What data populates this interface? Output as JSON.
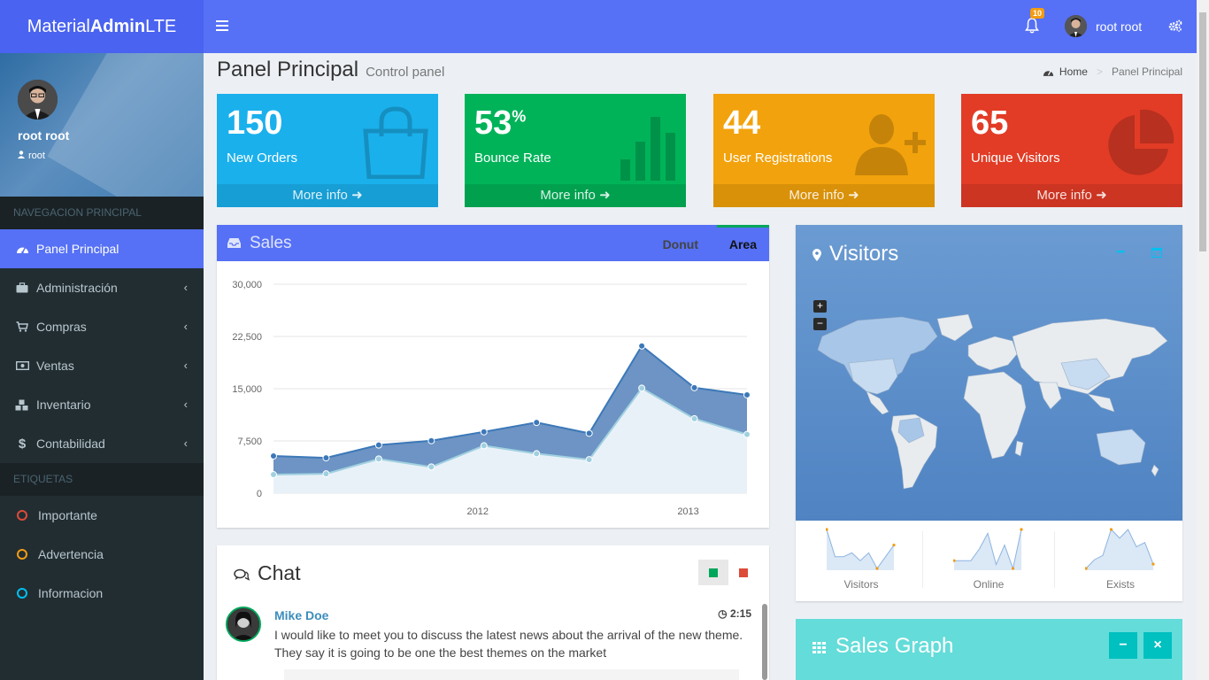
{
  "logo": {
    "prefix": "Material",
    "bold": "Admin",
    "suffix": "LTE"
  },
  "navbar": {
    "notifications": "10",
    "user": "root root"
  },
  "sidebar": {
    "user_name": "root root",
    "user_role": "root",
    "nav_header": "NAVEGACION PRINCIPAL",
    "items": [
      {
        "label": "Panel Principal",
        "icon": "dashboard-icon"
      },
      {
        "label": "Administración",
        "icon": "briefcase-icon"
      },
      {
        "label": "Compras",
        "icon": "cart-icon"
      },
      {
        "label": "Ventas",
        "icon": "money-icon"
      },
      {
        "label": "Inventario",
        "icon": "cubes-icon"
      },
      {
        "label": "Contabilidad",
        "icon": "dollar-icon"
      }
    ],
    "labels_header": "ETIQUETAS",
    "labels": [
      {
        "label": "Importante",
        "color": "#dd4b39"
      },
      {
        "label": "Advertencia",
        "color": "#f39c12"
      },
      {
        "label": "Informacion",
        "color": "#00c0ef"
      }
    ]
  },
  "content": {
    "title": "Panel Principal",
    "subtitle": "Control panel"
  },
  "breadcrumb": {
    "home": "Home",
    "current": "Panel Principal"
  },
  "stats": [
    {
      "value": "150",
      "suffix": "",
      "label": "New Orders",
      "more": "More info",
      "color": "#1ab0ec"
    },
    {
      "value": "53",
      "suffix": "%",
      "label": "Bounce Rate",
      "more": "More info",
      "color": "#00b359"
    },
    {
      "value": "44",
      "suffix": "",
      "label": "User Registrations",
      "more": "More info",
      "color": "#f2a20c"
    },
    {
      "value": "65",
      "suffix": "",
      "label": "Unique Visitors",
      "more": "More info",
      "color": "#e23c26"
    }
  ],
  "sales": {
    "title": "Sales",
    "tab_donut": "Donut",
    "tab_area": "Area"
  },
  "chart_data": {
    "type": "area",
    "x": [
      "2011 Q1",
      "2011 Q2",
      "2011 Q3",
      "2011 Q4",
      "2012 Q1",
      "2012 Q2",
      "2012 Q3",
      "2012 Q4",
      "2013 Q1",
      "2013 Q2"
    ],
    "x_tick_labels": [
      "2012",
      "2013"
    ],
    "series": [
      {
        "values": [
          2666,
          2778,
          4912,
          3767,
          6810,
          5670,
          4820,
          15073,
          10687,
          8432
        ]
      },
      {
        "values": [
          5332,
          5072,
          6912,
          7534,
          8810,
          10154,
          8599,
          21132,
          15147,
          14113
        ]
      }
    ],
    "yticks": [
      "30,000",
      "22,500",
      "15,000",
      "7,500",
      "0"
    ],
    "ylim": [
      0,
      30000
    ],
    "grid": true
  },
  "chat": {
    "title": "Chat",
    "messages": [
      {
        "name": "Mike Doe",
        "time": "2:15",
        "text": "I would like to meet you to discuss the latest news about the arrival of the new theme. They say it is going to be one the best themes on the market"
      }
    ]
  },
  "visitors": {
    "title": "Visitors",
    "zoom_in": "+",
    "zoom_out": "−",
    "sparks": [
      {
        "label": "Visitors",
        "values": [
          1000,
          300,
          300,
          400,
          200,
          400,
          0,
          300,
          600
        ]
      },
      {
        "label": "Online",
        "values": [
          200,
          200,
          200,
          500,
          900,
          100,
          600,
          0,
          1000
        ]
      },
      {
        "label": "Exists",
        "values": [
          0,
          200,
          300,
          900,
          700,
          900,
          500,
          600,
          100
        ]
      }
    ]
  },
  "sales_graph": {
    "title": "Sales Graph",
    "minus": "−",
    "close": "×"
  }
}
